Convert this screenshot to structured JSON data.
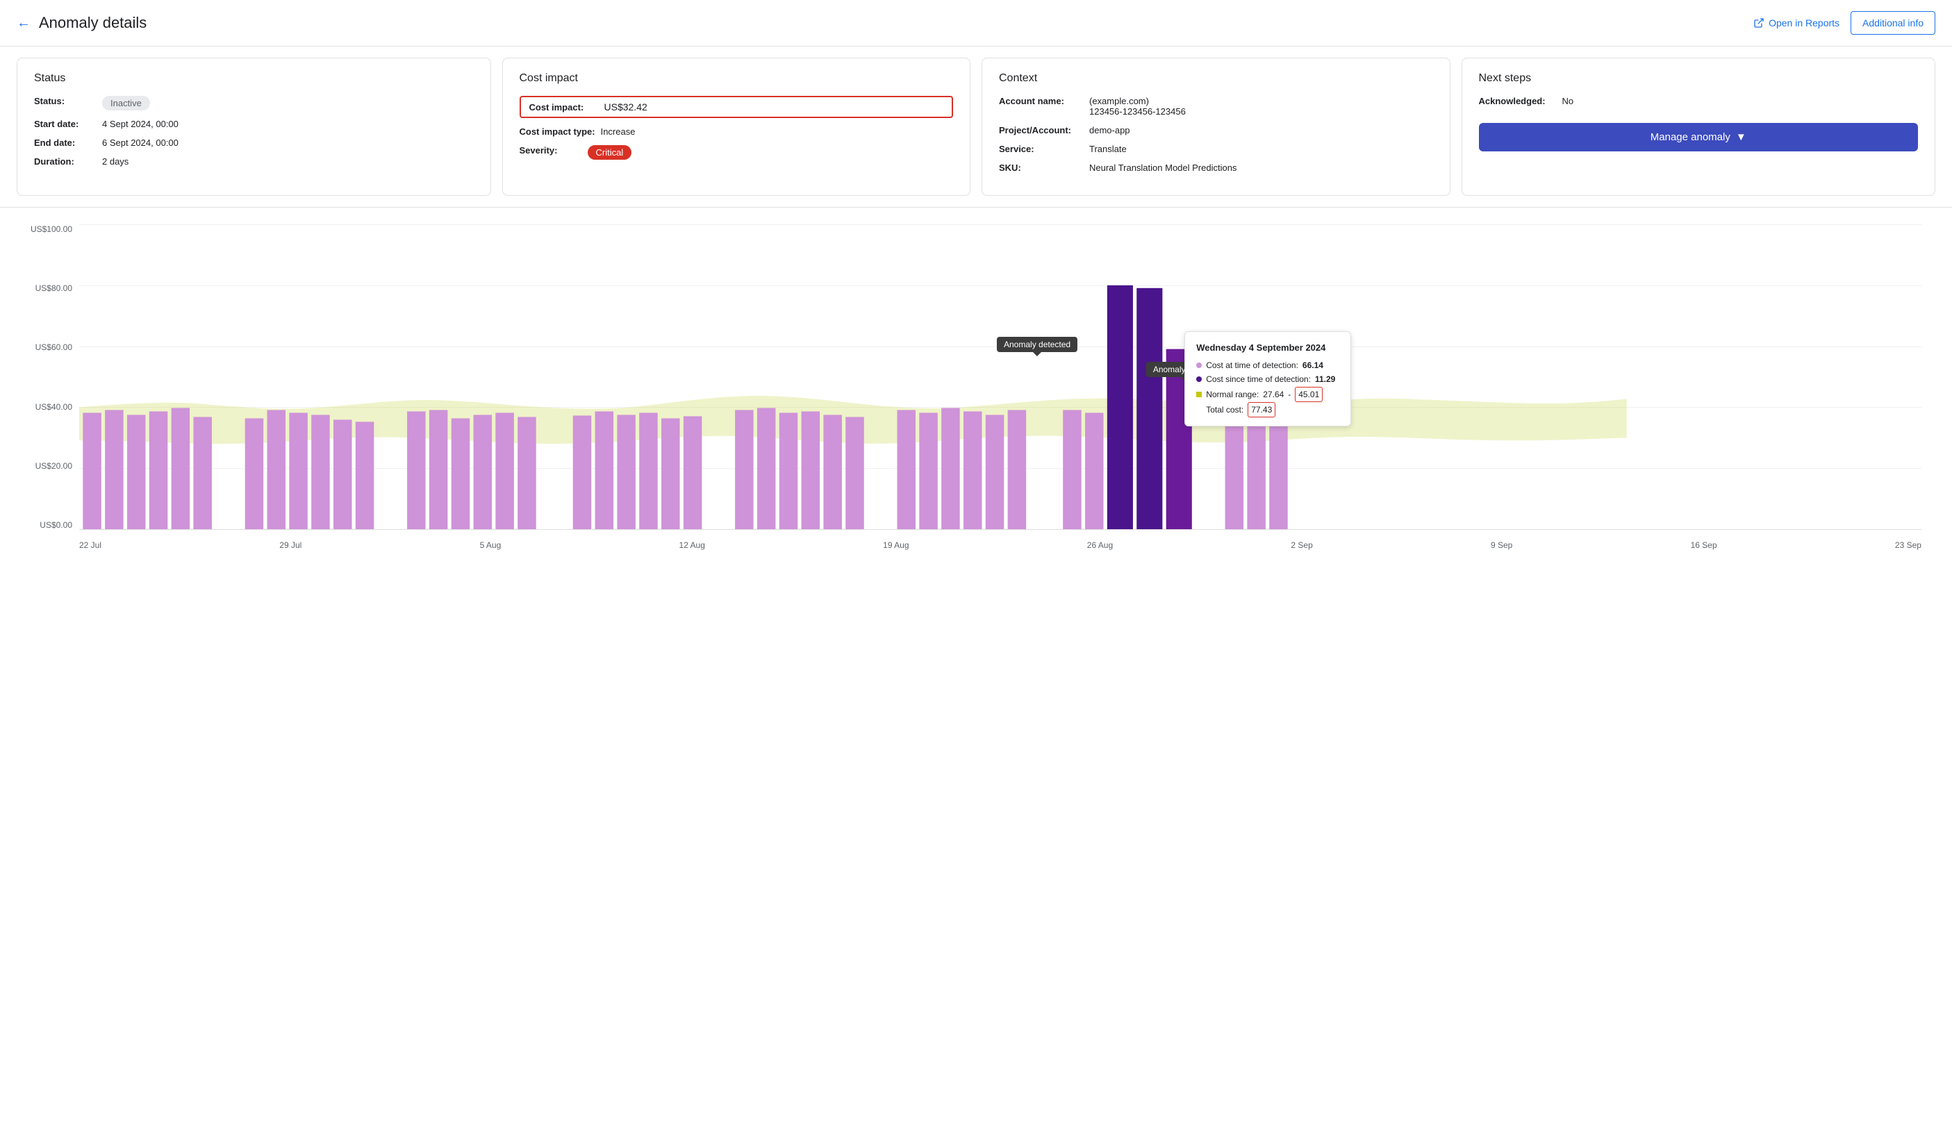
{
  "header": {
    "title": "Anomaly details",
    "back_icon": "←",
    "open_reports_label": "Open in Reports",
    "additional_info_label": "Additional info"
  },
  "status_card": {
    "title": "Status",
    "status_label": "Status:",
    "status_value": "Inactive",
    "start_date_label": "Start date:",
    "start_date_value": "4 Sept 2024, 00:00",
    "end_date_label": "End date:",
    "end_date_value": "6 Sept 2024, 00:00",
    "duration_label": "Duration:",
    "duration_value": "2 days"
  },
  "cost_card": {
    "title": "Cost impact",
    "cost_impact_label": "Cost impact:",
    "cost_impact_value": "US$32.42",
    "cost_impact_type_label": "Cost impact type:",
    "cost_impact_type_value": "Increase",
    "severity_label": "Severity:",
    "severity_value": "Critical"
  },
  "context_card": {
    "title": "Context",
    "account_name_label": "Account name:",
    "account_name_value": "(example.com)\n123456-123456-123456",
    "project_label": "Project/Account:",
    "project_value": "demo-app",
    "service_label": "Service:",
    "service_value": "Translate",
    "sku_label": "SKU:",
    "sku_value": "Neural Translation Model Predictions"
  },
  "nextsteps_card": {
    "title": "Next steps",
    "acknowledged_label": "Acknowledged:",
    "acknowledged_value": "No",
    "manage_btn_label": "Manage anomaly"
  },
  "chart": {
    "y_labels": [
      "US$100.00",
      "US$80.00",
      "US$60.00",
      "US$40.00",
      "US$20.00",
      "US$0.00"
    ],
    "x_labels": [
      "22 Jul",
      "29 Jul",
      "5 Aug",
      "12 Aug",
      "19 Aug",
      "26 Aug",
      "2 Sep",
      "9 Sep",
      "16 Sep",
      "23 Sep"
    ],
    "anomaly_detected_label": "Anomaly detected",
    "anomaly_inactive_label": "Anomaly inactive",
    "tooltip": {
      "title": "Wednesday 4 September 2024",
      "cost_detection_label": "Cost at time of detection:",
      "cost_detection_value": "66.14",
      "cost_since_label": "Cost since time of detection:",
      "cost_since_value": "11.29",
      "normal_range_label": "Normal range:",
      "normal_range_min": "27.64",
      "normal_range_max": "45.01",
      "total_cost_label": "Total cost:",
      "total_cost_value": "77.43"
    }
  }
}
